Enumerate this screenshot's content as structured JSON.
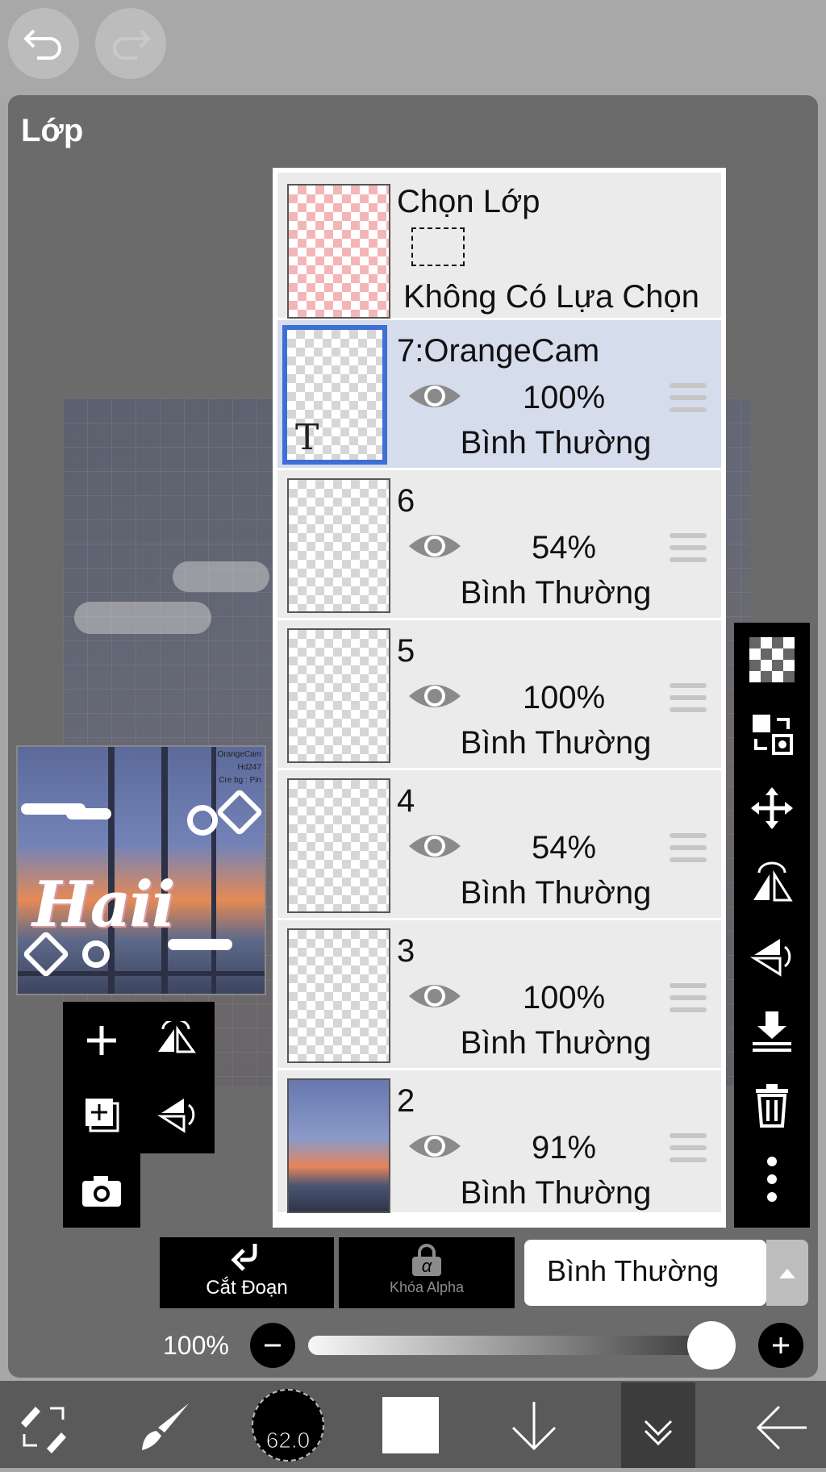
{
  "panel": {
    "title": "Lớp"
  },
  "preview": {
    "title_text": "Haii",
    "credit_lines": [
      "OrangeCam",
      "Hd247",
      "Cre bg : Pin"
    ]
  },
  "selection_row": {
    "title": "Chọn Lớp",
    "subtitle": "Không Có Lựa Chọn"
  },
  "layers": [
    {
      "name": "7:OrangeCam",
      "opacity": "100%",
      "blend": "Bình Thường",
      "selected": true,
      "thumb_glyph": "T"
    },
    {
      "name": "6",
      "opacity": "54%",
      "blend": "Bình Thường"
    },
    {
      "name": "5",
      "opacity": "100%",
      "blend": "Bình Thường"
    },
    {
      "name": "4",
      "opacity": "54%",
      "blend": "Bình Thường"
    },
    {
      "name": "3",
      "opacity": "100%",
      "blend": "Bình Thường"
    },
    {
      "name": "2",
      "opacity": "91%",
      "blend": "Bình Thường"
    }
  ],
  "bottom_controls": {
    "clip_label": "Cắt Đoạn",
    "alpha_lock_label": "Khóa Alpha",
    "alpha_glyph": "α",
    "blend_mode": "Bình Thường",
    "opacity_label": "100%",
    "opacity_value": 1.0
  },
  "toolbar": {
    "brush_size": "62.0"
  },
  "colors": {
    "selected_border": "#3d6fd6",
    "selected_row": "#d5dcec",
    "panel": "#6b6b6b"
  }
}
